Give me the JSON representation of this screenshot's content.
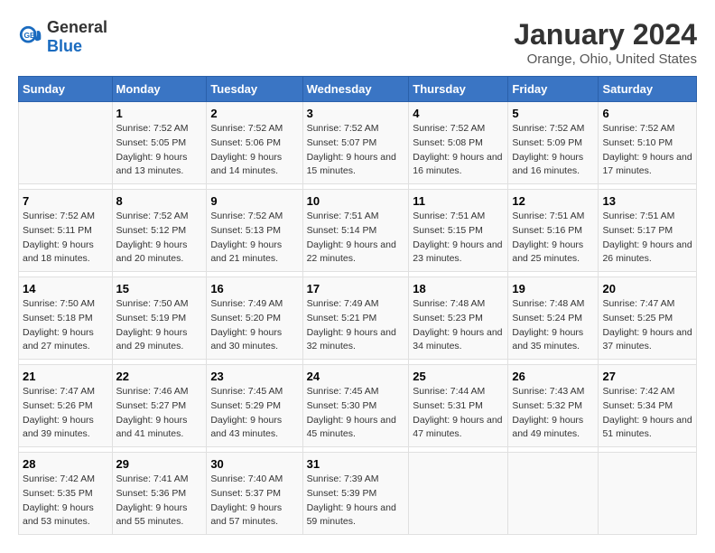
{
  "logo": {
    "general": "General",
    "blue": "Blue"
  },
  "header": {
    "title": "January 2024",
    "subtitle": "Orange, Ohio, United States"
  },
  "weekdays": [
    "Sunday",
    "Monday",
    "Tuesday",
    "Wednesday",
    "Thursday",
    "Friday",
    "Saturday"
  ],
  "weeks": [
    [
      {
        "day": "",
        "sunrise": "",
        "sunset": "",
        "daylight": ""
      },
      {
        "day": "1",
        "sunrise": "Sunrise: 7:52 AM",
        "sunset": "Sunset: 5:05 PM",
        "daylight": "Daylight: 9 hours and 13 minutes."
      },
      {
        "day": "2",
        "sunrise": "Sunrise: 7:52 AM",
        "sunset": "Sunset: 5:06 PM",
        "daylight": "Daylight: 9 hours and 14 minutes."
      },
      {
        "day": "3",
        "sunrise": "Sunrise: 7:52 AM",
        "sunset": "Sunset: 5:07 PM",
        "daylight": "Daylight: 9 hours and 15 minutes."
      },
      {
        "day": "4",
        "sunrise": "Sunrise: 7:52 AM",
        "sunset": "Sunset: 5:08 PM",
        "daylight": "Daylight: 9 hours and 16 minutes."
      },
      {
        "day": "5",
        "sunrise": "Sunrise: 7:52 AM",
        "sunset": "Sunset: 5:09 PM",
        "daylight": "Daylight: 9 hours and 16 minutes."
      },
      {
        "day": "6",
        "sunrise": "Sunrise: 7:52 AM",
        "sunset": "Sunset: 5:10 PM",
        "daylight": "Daylight: 9 hours and 17 minutes."
      }
    ],
    [
      {
        "day": "7",
        "sunrise": "Sunrise: 7:52 AM",
        "sunset": "Sunset: 5:11 PM",
        "daylight": "Daylight: 9 hours and 18 minutes."
      },
      {
        "day": "8",
        "sunrise": "Sunrise: 7:52 AM",
        "sunset": "Sunset: 5:12 PM",
        "daylight": "Daylight: 9 hours and 20 minutes."
      },
      {
        "day": "9",
        "sunrise": "Sunrise: 7:52 AM",
        "sunset": "Sunset: 5:13 PM",
        "daylight": "Daylight: 9 hours and 21 minutes."
      },
      {
        "day": "10",
        "sunrise": "Sunrise: 7:51 AM",
        "sunset": "Sunset: 5:14 PM",
        "daylight": "Daylight: 9 hours and 22 minutes."
      },
      {
        "day": "11",
        "sunrise": "Sunrise: 7:51 AM",
        "sunset": "Sunset: 5:15 PM",
        "daylight": "Daylight: 9 hours and 23 minutes."
      },
      {
        "day": "12",
        "sunrise": "Sunrise: 7:51 AM",
        "sunset": "Sunset: 5:16 PM",
        "daylight": "Daylight: 9 hours and 25 minutes."
      },
      {
        "day": "13",
        "sunrise": "Sunrise: 7:51 AM",
        "sunset": "Sunset: 5:17 PM",
        "daylight": "Daylight: 9 hours and 26 minutes."
      }
    ],
    [
      {
        "day": "14",
        "sunrise": "Sunrise: 7:50 AM",
        "sunset": "Sunset: 5:18 PM",
        "daylight": "Daylight: 9 hours and 27 minutes."
      },
      {
        "day": "15",
        "sunrise": "Sunrise: 7:50 AM",
        "sunset": "Sunset: 5:19 PM",
        "daylight": "Daylight: 9 hours and 29 minutes."
      },
      {
        "day": "16",
        "sunrise": "Sunrise: 7:49 AM",
        "sunset": "Sunset: 5:20 PM",
        "daylight": "Daylight: 9 hours and 30 minutes."
      },
      {
        "day": "17",
        "sunrise": "Sunrise: 7:49 AM",
        "sunset": "Sunset: 5:21 PM",
        "daylight": "Daylight: 9 hours and 32 minutes."
      },
      {
        "day": "18",
        "sunrise": "Sunrise: 7:48 AM",
        "sunset": "Sunset: 5:23 PM",
        "daylight": "Daylight: 9 hours and 34 minutes."
      },
      {
        "day": "19",
        "sunrise": "Sunrise: 7:48 AM",
        "sunset": "Sunset: 5:24 PM",
        "daylight": "Daylight: 9 hours and 35 minutes."
      },
      {
        "day": "20",
        "sunrise": "Sunrise: 7:47 AM",
        "sunset": "Sunset: 5:25 PM",
        "daylight": "Daylight: 9 hours and 37 minutes."
      }
    ],
    [
      {
        "day": "21",
        "sunrise": "Sunrise: 7:47 AM",
        "sunset": "Sunset: 5:26 PM",
        "daylight": "Daylight: 9 hours and 39 minutes."
      },
      {
        "day": "22",
        "sunrise": "Sunrise: 7:46 AM",
        "sunset": "Sunset: 5:27 PM",
        "daylight": "Daylight: 9 hours and 41 minutes."
      },
      {
        "day": "23",
        "sunrise": "Sunrise: 7:45 AM",
        "sunset": "Sunset: 5:29 PM",
        "daylight": "Daylight: 9 hours and 43 minutes."
      },
      {
        "day": "24",
        "sunrise": "Sunrise: 7:45 AM",
        "sunset": "Sunset: 5:30 PM",
        "daylight": "Daylight: 9 hours and 45 minutes."
      },
      {
        "day": "25",
        "sunrise": "Sunrise: 7:44 AM",
        "sunset": "Sunset: 5:31 PM",
        "daylight": "Daylight: 9 hours and 47 minutes."
      },
      {
        "day": "26",
        "sunrise": "Sunrise: 7:43 AM",
        "sunset": "Sunset: 5:32 PM",
        "daylight": "Daylight: 9 hours and 49 minutes."
      },
      {
        "day": "27",
        "sunrise": "Sunrise: 7:42 AM",
        "sunset": "Sunset: 5:34 PM",
        "daylight": "Daylight: 9 hours and 51 minutes."
      }
    ],
    [
      {
        "day": "28",
        "sunrise": "Sunrise: 7:42 AM",
        "sunset": "Sunset: 5:35 PM",
        "daylight": "Daylight: 9 hours and 53 minutes."
      },
      {
        "day": "29",
        "sunrise": "Sunrise: 7:41 AM",
        "sunset": "Sunset: 5:36 PM",
        "daylight": "Daylight: 9 hours and 55 minutes."
      },
      {
        "day": "30",
        "sunrise": "Sunrise: 7:40 AM",
        "sunset": "Sunset: 5:37 PM",
        "daylight": "Daylight: 9 hours and 57 minutes."
      },
      {
        "day": "31",
        "sunrise": "Sunrise: 7:39 AM",
        "sunset": "Sunset: 5:39 PM",
        "daylight": "Daylight: 9 hours and 59 minutes."
      },
      {
        "day": "",
        "sunrise": "",
        "sunset": "",
        "daylight": ""
      },
      {
        "day": "",
        "sunrise": "",
        "sunset": "",
        "daylight": ""
      },
      {
        "day": "",
        "sunrise": "",
        "sunset": "",
        "daylight": ""
      }
    ]
  ]
}
